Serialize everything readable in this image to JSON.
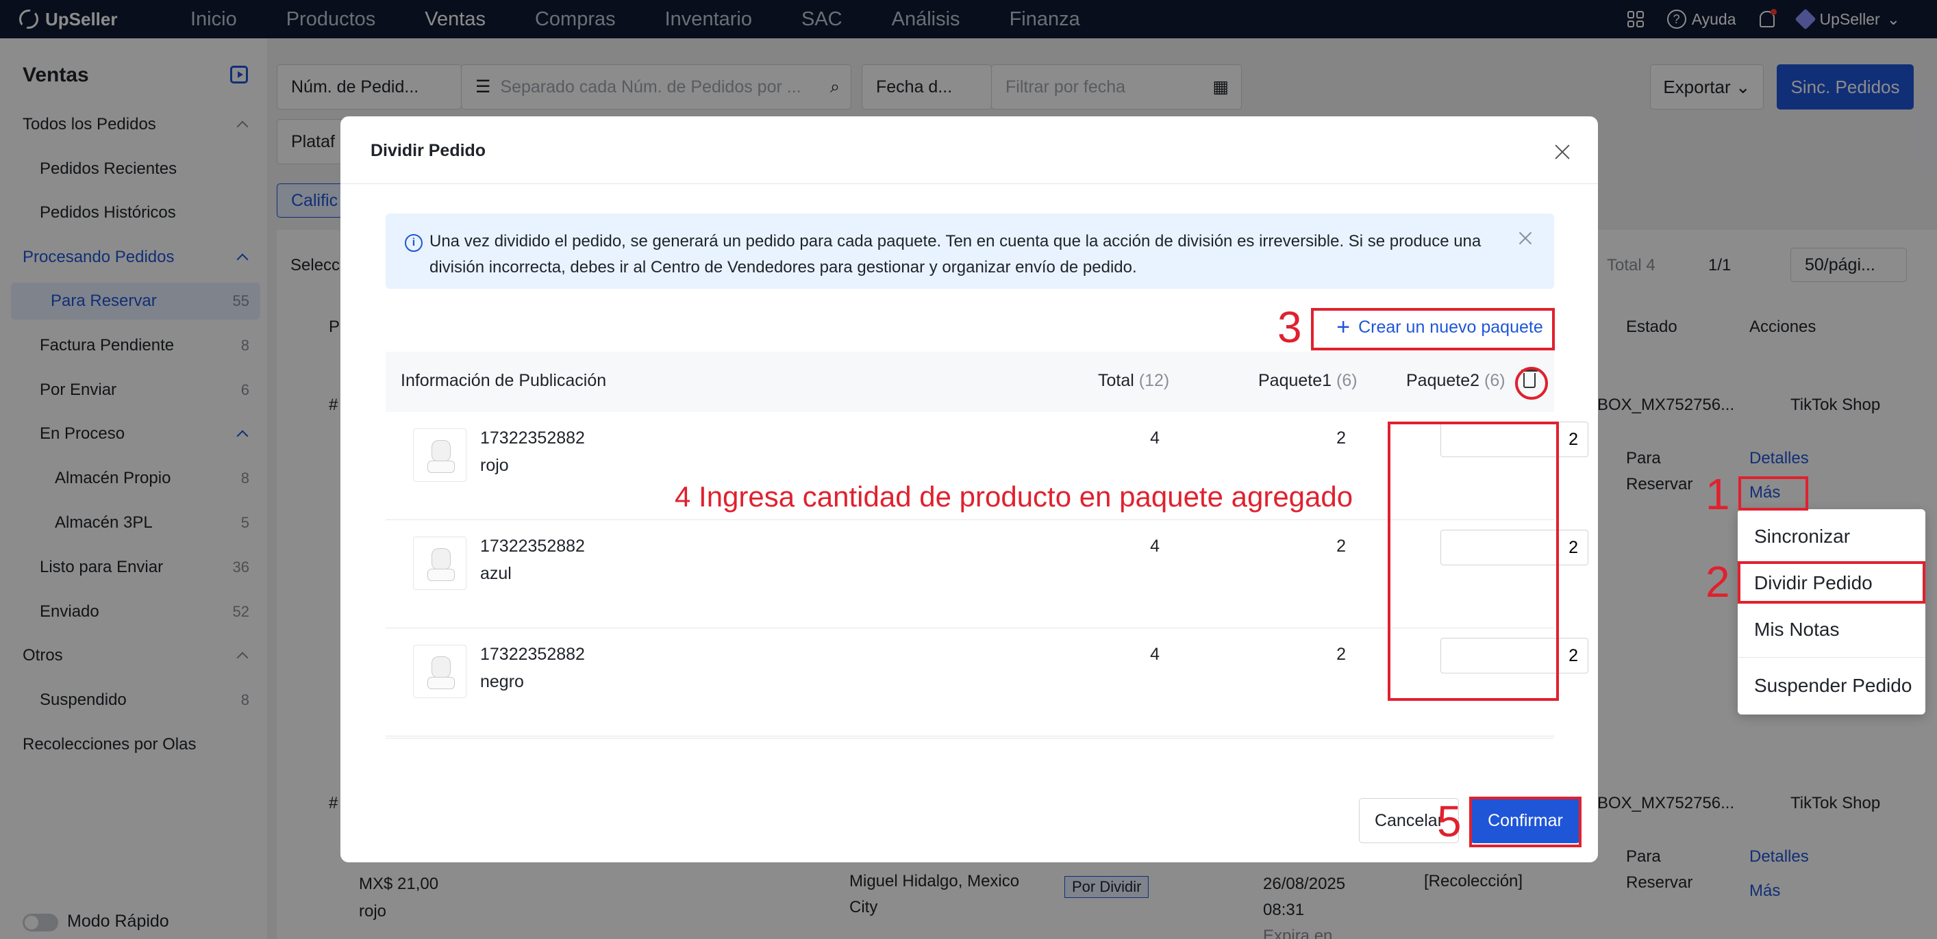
{
  "app": {
    "name": "UpSeller"
  },
  "nav": [
    "Inicio",
    "Productos",
    "Ventas",
    "Compras",
    "Inventario",
    "SAC",
    "Análisis",
    "Finanza"
  ],
  "nav_active": "Ventas",
  "topright": {
    "help": "Ayuda",
    "user": "UpSeller"
  },
  "sidebar": {
    "title": "Ventas",
    "items": [
      {
        "label": "Todos los Pedidos",
        "count": ""
      },
      {
        "label": "Pedidos Recientes",
        "count": ""
      },
      {
        "label": "Pedidos Históricos",
        "count": ""
      },
      {
        "label": "Procesando Pedidos",
        "count": ""
      },
      {
        "label": "Para Reservar",
        "count": "55"
      },
      {
        "label": "Factura Pendiente",
        "count": "8"
      },
      {
        "label": "Por Enviar",
        "count": "6"
      },
      {
        "label": "En Proceso",
        "count": ""
      },
      {
        "label": "Almacén Propio",
        "count": "8"
      },
      {
        "label": "Almacén 3PL",
        "count": "5"
      },
      {
        "label": "Listo para Enviar",
        "count": "36"
      },
      {
        "label": "Enviado",
        "count": "52"
      },
      {
        "label": "Otros",
        "count": ""
      },
      {
        "label": "Suspendido",
        "count": "8"
      },
      {
        "label": "Recolecciones por Olas",
        "count": ""
      }
    ],
    "fast_mode": "Modo Rápido"
  },
  "filters": {
    "order_type": "Núm. de Pedid...",
    "search_placeholder": "Separado cada Núm. de Pedidos por ...",
    "date_type": "Fecha d...",
    "date_placeholder": "Filtrar por fecha",
    "platform": "Plataf",
    "tag": "Calific",
    "select": "Selecc"
  },
  "toolbar": {
    "export": "Exportar",
    "sync": "Sinc. Pedidos"
  },
  "pagination": {
    "total": "Total 4",
    "page": "1/1",
    "per_page": "50/pági..."
  },
  "table_bg": {
    "headers": {
      "estado": "Estado",
      "acciones": "Acciones",
      "first": "P"
    },
    "row1": {
      "id": "#",
      "logistics": "BOX_MX752756...",
      "shop": "TikTok Shop",
      "estado1": "Para",
      "estado2": "Reservar",
      "detalles": "Detalles",
      "mas": "Más"
    },
    "row2": {
      "id": "#",
      "logistics": "BOX_MX752756...",
      "shop": "TikTok Shop",
      "price": "MX$ 21,00",
      "variant": "rojo",
      "address1": "Miguel Hidalgo, Mexico",
      "address2": "City",
      "badge": "Por Dividir",
      "date1": "26/08/2025",
      "date2": "08:31",
      "date3": "Expira en",
      "pickup": "[Recolección]",
      "estado1": "Para",
      "estado2": "Reservar",
      "detalles": "Detalles",
      "mas": "Más"
    }
  },
  "dropdown": {
    "items": [
      "Sincronizar",
      "Dividir Pedido",
      "Mis Notas",
      "Suspender Pedido"
    ]
  },
  "modal": {
    "title": "Dividir Pedido",
    "alert": "Una vez dividido el pedido, se generará un pedido para cada paquete. Ten en cuenta que la acción de división es irreversible. Si se produce una división incorrecta, debes ir al Centro de Vendedores para gestionar y organizar envío de pedido.",
    "create_package": "Crear un nuevo paquete",
    "headers": {
      "info": "Información de Publicación",
      "total": "Total",
      "total_count": "(12)",
      "pkg1": "Paquete1",
      "pkg1_count": "(6)",
      "pkg2": "Paquete2",
      "pkg2_count": "(6)"
    },
    "rows": [
      {
        "sku": "17322352882",
        "variant": "rojo",
        "total": "4",
        "pkg1": "2",
        "pkg2": "2"
      },
      {
        "sku": "17322352882",
        "variant": "azul",
        "total": "4",
        "pkg1": "2",
        "pkg2": "2"
      },
      {
        "sku": "17322352882",
        "variant": "negro",
        "total": "4",
        "pkg1": "2",
        "pkg2": "2"
      }
    ],
    "cancel": "Cancelar",
    "confirm": "Confirmar"
  },
  "annotations": {
    "n1": "1",
    "n2": "2",
    "n3": "3",
    "n4": "4 Ingresa cantidad de producto en paquete agregado",
    "n5": "5"
  },
  "colors": {
    "accent": "#1f56d8",
    "annotation": "#e0212e",
    "topbar": "#0f1b33"
  }
}
